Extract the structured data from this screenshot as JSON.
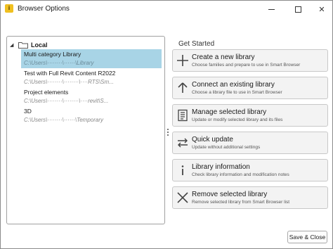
{
  "window": {
    "title": "Browser Options",
    "app_icon_letter": "i"
  },
  "tree": {
    "root_label": "Local",
    "items": [
      {
        "name": "Multi category Library",
        "path": "C:\\Users\\········\\······\\Library",
        "selected": true
      },
      {
        "name": "Test with Full Revit Content R2022",
        "path": "C:\\Users\\········\\········\\····RTS\\Sm...",
        "selected": false
      },
      {
        "name": "Project elements",
        "path": "C:\\Users\\········\\········\\····revit\\S...",
        "selected": false
      },
      {
        "name": "3D",
        "path": "C:\\Users\\········\\······\\Temporary",
        "selected": false
      }
    ]
  },
  "get_started": {
    "title": "Get Started",
    "actions": [
      {
        "icon": "plus-icon",
        "title": "Create a new library",
        "desc": "Choose families and prepare to use in Smart Browser"
      },
      {
        "icon": "arrow-up-icon",
        "title": "Connect an existing library",
        "desc": "Choose a library file to use in Smart Browser"
      },
      {
        "icon": "document-list-icon",
        "title": "Manage selected library",
        "desc": "Update or modify selected library and its files"
      },
      {
        "icon": "swap-arrows-icon",
        "title": "Quick update",
        "desc": "Update without additional settings"
      },
      {
        "icon": "info-icon",
        "title": "Library information",
        "desc": "Check library information and modification notes"
      },
      {
        "icon": "close-x-icon",
        "title": "Remove selected library",
        "desc": "Remove selected library from Smart Browser list"
      }
    ]
  },
  "footer": {
    "save_close_label": "Save & Close"
  },
  "colors": {
    "selection": "#a8d4e6",
    "app_icon": "#f0c020"
  }
}
